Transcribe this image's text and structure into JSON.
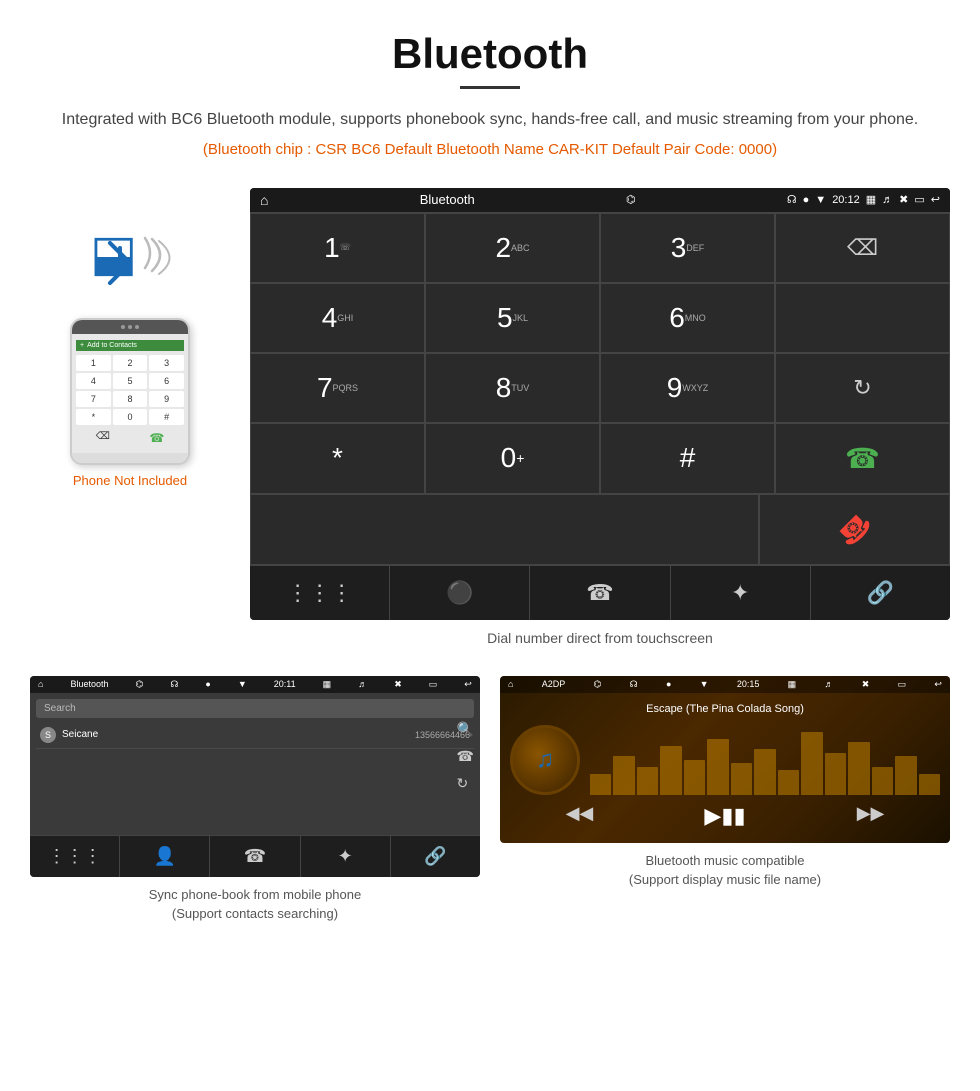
{
  "page": {
    "title": "Bluetooth",
    "description": "Integrated with BC6 Bluetooth module, supports phonebook sync, hands-free call, and music streaming from your phone.",
    "specs": "(Bluetooth chip : CSR BC6    Default Bluetooth Name CAR-KIT    Default Pair Code: 0000)"
  },
  "dialer": {
    "app_title": "Bluetooth",
    "time": "20:12",
    "keys": [
      {
        "number": "1",
        "sub": ""
      },
      {
        "number": "2",
        "sub": "ABC"
      },
      {
        "number": "3",
        "sub": "DEF"
      },
      {
        "number": "4",
        "sub": "GHI"
      },
      {
        "number": "5",
        "sub": "JKL"
      },
      {
        "number": "6",
        "sub": "MNO"
      },
      {
        "number": "7",
        "sub": "PQRS"
      },
      {
        "number": "8",
        "sub": "TUV"
      },
      {
        "number": "9",
        "sub": "WXYZ"
      },
      {
        "number": "*",
        "sub": ""
      },
      {
        "number": "0",
        "sub": "+"
      },
      {
        "number": "#",
        "sub": ""
      }
    ],
    "caption": "Dial number direct from touchscreen"
  },
  "contacts": {
    "app_title": "Bluetooth",
    "time": "20:11",
    "search_placeholder": "Search",
    "contact_name": "Seicane",
    "contact_number": "13566664466",
    "caption_line1": "Sync phone-book from mobile phone",
    "caption_line2": "(Support contacts searching)"
  },
  "music": {
    "app_title": "A2DP",
    "time": "20:15",
    "song_title": "Escape (The Pina Colada Song)",
    "caption_line1": "Bluetooth music compatible",
    "caption_line2": "(Support display music file name)"
  },
  "phone_label": "Phone Not Included",
  "phone_keypad": [
    "1",
    "2",
    "3",
    "4",
    "5",
    "6",
    "7",
    "8",
    "9",
    "*",
    "0",
    "#"
  ]
}
